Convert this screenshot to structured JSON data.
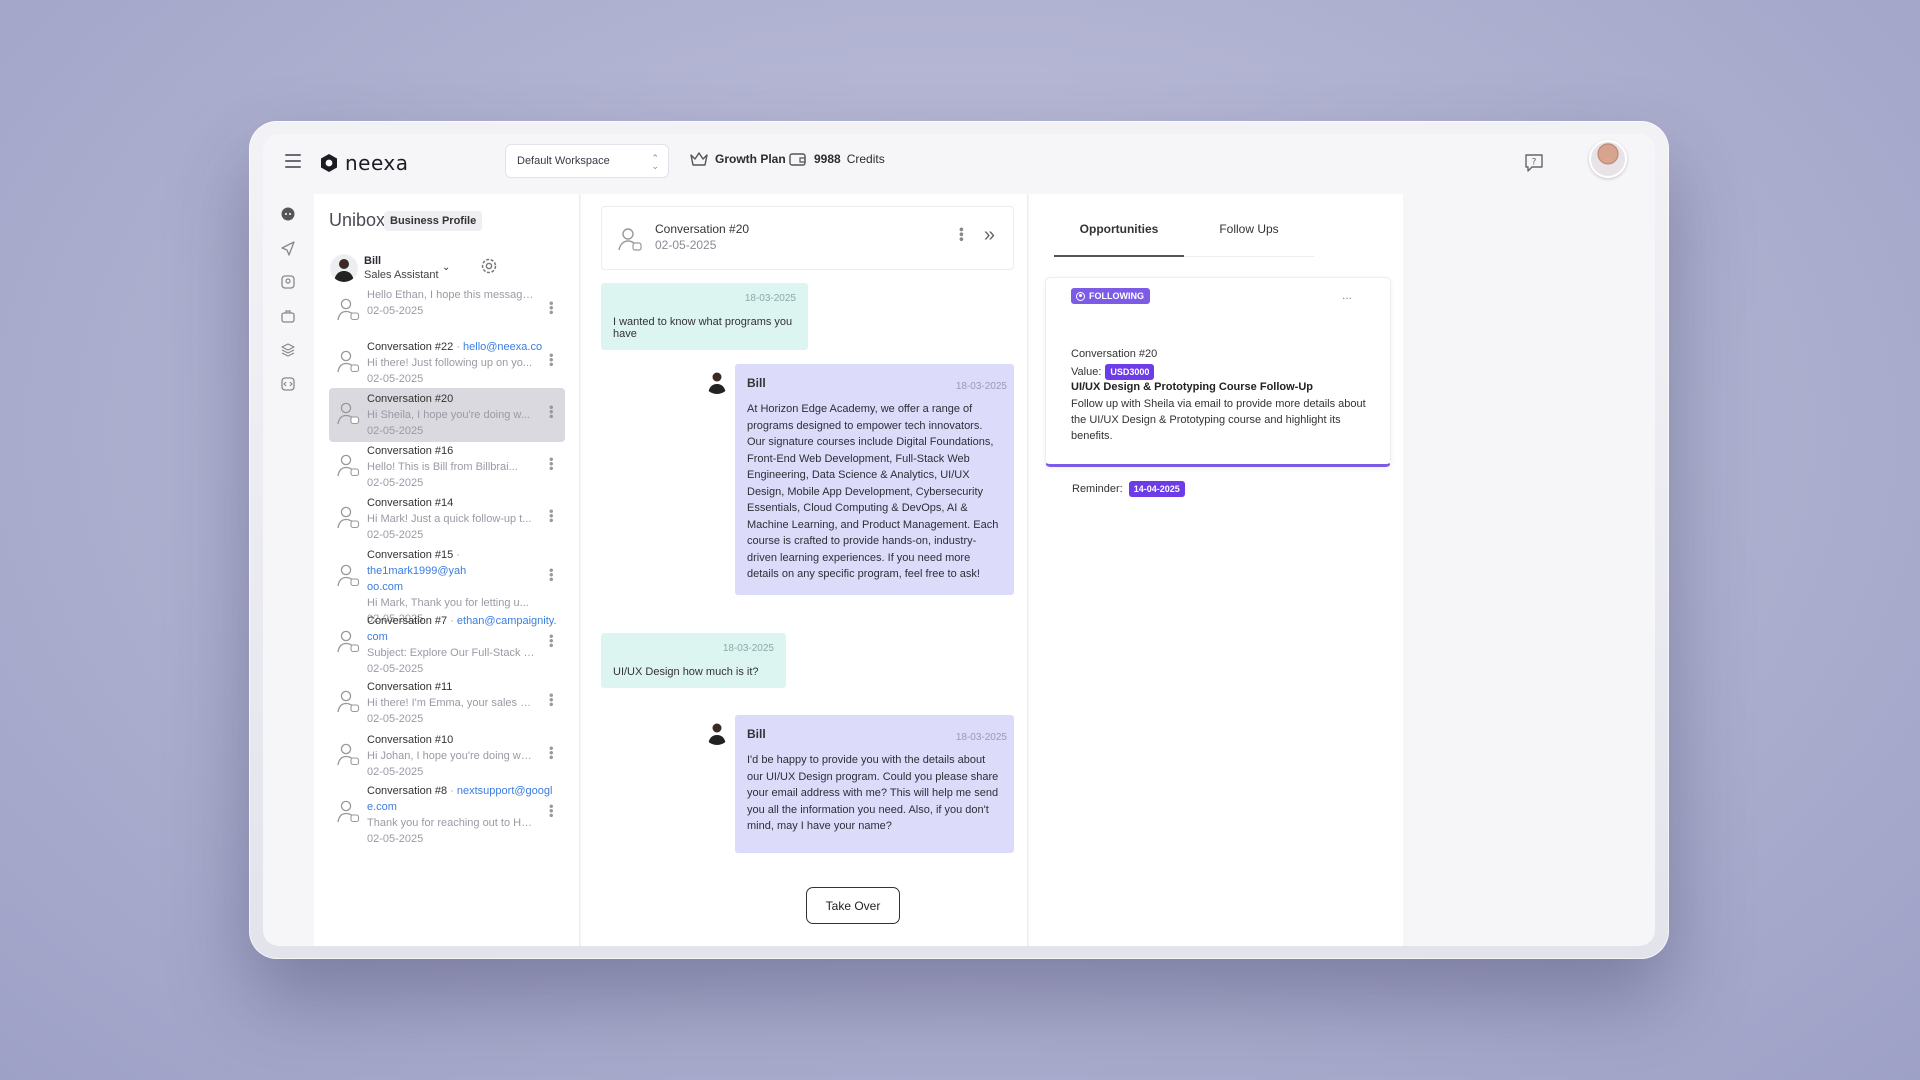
{
  "brand": {
    "name": "neexa"
  },
  "topbar": {
    "workspace": "Default Workspace",
    "plan": "Growth Plan",
    "credits_value": "9988",
    "credits_label": "Credits"
  },
  "inbox": {
    "title": "Unibox",
    "badge": "Business Profile",
    "agent": {
      "name": "Bill",
      "role": "Sales Assistant"
    },
    "conversations": [
      {
        "name": "",
        "email": "",
        "preview": "Hello Ethan, I hope this message...",
        "date": "02-05-2025"
      },
      {
        "name": "Conversation #22",
        "email": "hello@neexa.co",
        "preview": "Hi there! Just following up on yo...",
        "date": "02-05-2025"
      },
      {
        "name": "Conversation #20",
        "email": "",
        "preview": "Hi Sheila, I hope you're doing w...",
        "date": "02-05-2025",
        "active": true
      },
      {
        "name": "Conversation #16",
        "email": "",
        "preview": "Hello! This is Bill from Billbrai...",
        "date": "02-05-2025"
      },
      {
        "name": "Conversation #14",
        "email": "",
        "preview": "Hi Mark! Just a quick follow-up t...",
        "date": "02-05-2025"
      },
      {
        "name": "Conversation #15",
        "email": "the1mark1999@yahoo.com",
        "email_l1": "the1mark1999@yah",
        "email_l2": "oo.com",
        "preview": "Hi Mark, Thank you for letting u...",
        "date": "02-05-2025"
      },
      {
        "name": "Conversation #7",
        "email": "ethan@campaignity.com",
        "email_l1": "ethan@campaignity.",
        "email_l2": "com",
        "preview": "Subject: Explore Our Full-Stack W...",
        "date": "02-05-2025"
      },
      {
        "name": "Conversation #11",
        "email": "",
        "preview": "Hi there! I'm Emma, your sales ag...",
        "date": "02-05-2025"
      },
      {
        "name": "Conversation #10",
        "email": "",
        "preview": "Hi Johan, I hope you're doing wel...",
        "date": "02-05-2025"
      },
      {
        "name": "Conversation #8",
        "email": "nextsupport@google.com",
        "email_l1": "nextsupport@googl",
        "email_l2": "e.com",
        "preview": "Thank you for reaching out to Hor...",
        "date": "02-05-2025"
      }
    ]
  },
  "chat": {
    "title": "Conversation #20",
    "date": "02-05-2025",
    "messages": [
      {
        "from": "user",
        "date": "18-03-2025",
        "text": "I wanted to know what programs you have"
      },
      {
        "from": "bot",
        "name": "Bill",
        "date": "18-03-2025",
        "text": "At Horizon Edge Academy, we offer a range of programs designed to empower tech innovators. Our signature courses include Digital Foundations, Front-End Web Development, Full-Stack Web Engineering, Data Science & Analytics, UI/UX Design, Mobile App Development, Cybersecurity Essentials, Cloud Computing & DevOps, AI & Machine Learning, and Product Management. Each course is crafted to provide hands-on, industry-driven learning experiences. If you need more details on any specific program, feel free to ask!"
      },
      {
        "from": "user",
        "date": "18-03-2025",
        "text": "UI/UX Design how much is it?"
      },
      {
        "from": "bot",
        "name": "Bill",
        "date": "18-03-2025",
        "text": "I'd be happy to provide you with the details about our UI/UX Design program. Could you please share your email address with me? This will help me send you all the information you need. Also, if you don't mind, may I have your name?"
      }
    ],
    "take_over": "Take Over"
  },
  "details": {
    "tabs": [
      "Opportunities",
      "Follow Ups"
    ],
    "card": {
      "status": "FOLLOWING",
      "conversation": "Conversation #20",
      "value_label": "Value:",
      "value": "USD3000",
      "title": "UI/UX Design & Prototyping Course Follow-Up",
      "description": "Follow up with Sheila via email to provide more details about the UI/UX Design & Prototyping course and highlight its benefits.",
      "reminder_label": "Reminder:",
      "reminder_date": "14-04-2025",
      "more": "..."
    }
  },
  "colors": {
    "accent": "#7c5ce6",
    "pill": "#6d3ce8",
    "user_bubble": "#ddf5f1",
    "bot_bubble": "#dcdcfa",
    "link": "#3b7de0"
  },
  "icons": [
    "menu-icon",
    "chat-icon",
    "send-icon",
    "contacts-icon",
    "briefcase-icon",
    "layers-icon",
    "code-icon",
    "help-chat-icon",
    "gear-icon",
    "chevron-down-icon",
    "crown-icon",
    "wallet-icon",
    "double-chevron-right-icon",
    "user-placeholder-icon"
  ]
}
